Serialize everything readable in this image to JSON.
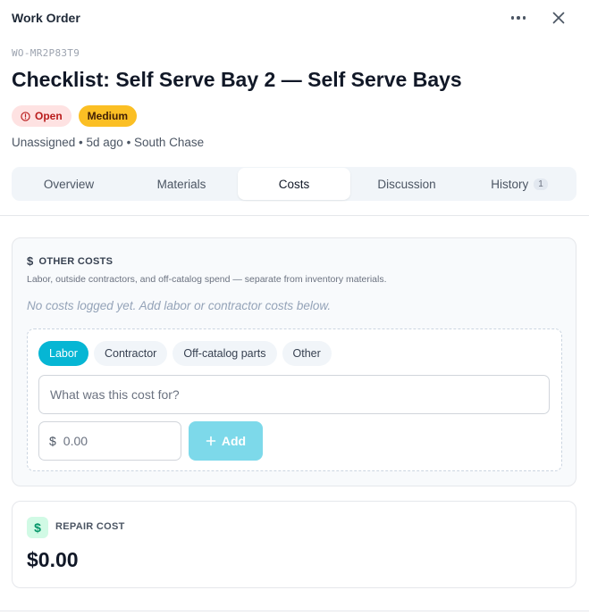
{
  "header": {
    "title": "Work Order",
    "more_icon": "more-horizontal-icon",
    "close_icon": "close-icon"
  },
  "work_order": {
    "id": "WO-MR2P83T9",
    "title": "Checklist: Self Serve Bay 2 — Self Serve Bays",
    "status": "Open",
    "priority": "Medium",
    "meta": "Unassigned • 5d ago • South Chase"
  },
  "colors": {
    "status_open_bg": "#fee2e2",
    "status_open_fg": "#b91c1c",
    "priority_medium": "#fbbf24",
    "accent": "#06b6d4",
    "add_button_disabled": "#7dd9ea"
  },
  "tabs": [
    {
      "label": "Overview"
    },
    {
      "label": "Materials"
    },
    {
      "label": "Costs",
      "active": true
    },
    {
      "label": "Discussion"
    },
    {
      "label": "History",
      "count": "1"
    }
  ],
  "other_costs": {
    "icon": "$",
    "heading": "OTHER COSTS",
    "description": "Labor, outside contractors, and off-catalog spend — separate from inventory materials.",
    "empty_message": "No costs logged yet. Add labor or contractor costs below.",
    "categories": [
      "Labor",
      "Contractor",
      "Off-catalog parts",
      "Other"
    ],
    "selected_category": "Labor",
    "description_placeholder": "What was this cost for?",
    "currency_symbol": "$",
    "amount_placeholder": "0.00",
    "add_label": "Add"
  },
  "repair_cost": {
    "icon": "$",
    "label": "REPAIR COST",
    "value": "$0.00"
  }
}
